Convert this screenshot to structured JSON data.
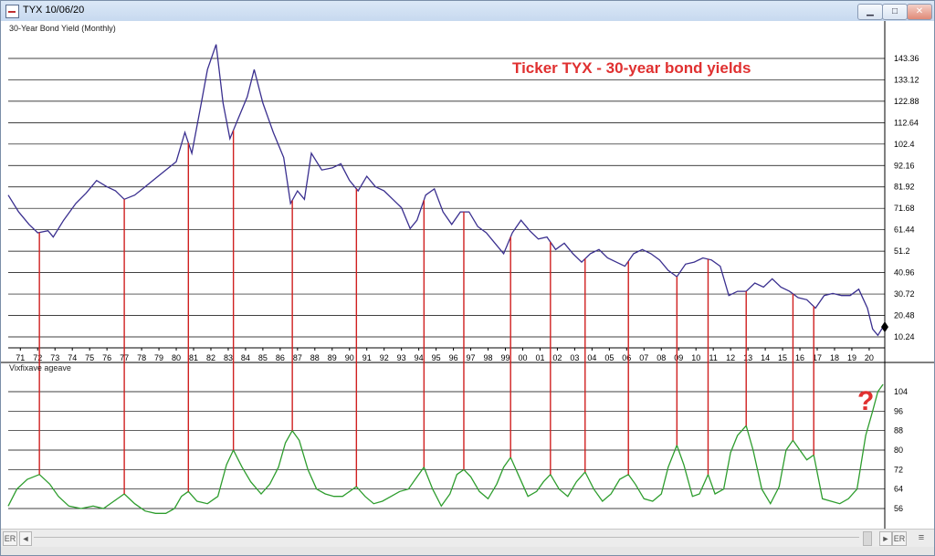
{
  "window": {
    "title": "TYX 10/06/20",
    "minimize_icon": "minimize-icon",
    "maximize_icon": "maximize-icon",
    "close_icon": "close-icon"
  },
  "chart_data": [
    {
      "type": "line",
      "title": "30-Year Bond Yield (Monthly)",
      "annotation": "Ticker TYX - 30-year bond yields",
      "ytick_labels": [
        "10.24",
        "20.48",
        "30.72",
        "40.96",
        "51.2",
        "61.44",
        "71.68",
        "81.92",
        "92.16",
        "102.4",
        "112.64",
        "122.88",
        "133.12",
        "143.36"
      ],
      "yticks": [
        10.24,
        20.48,
        30.72,
        40.96,
        51.2,
        61.44,
        71.68,
        81.92,
        92.16,
        102.4,
        112.64,
        122.88,
        133.12,
        143.36
      ],
      "ylim": [
        5,
        156
      ],
      "xlim": [
        1970.3,
        2020.9
      ],
      "xtick_labels": [
        "71",
        "72",
        "73",
        "74",
        "75",
        "76",
        "77",
        "78",
        "79",
        "80",
        "81",
        "82",
        "83",
        "84",
        "85",
        "86",
        "87",
        "88",
        "89",
        "90",
        "91",
        "92",
        "93",
        "94",
        "95",
        "96",
        "97",
        "98",
        "99",
        "00",
        "01",
        "02",
        "03",
        "04",
        "05",
        "06",
        "07",
        "08",
        "09",
        "10",
        "11",
        "12",
        "13",
        "14",
        "15",
        "16",
        "17",
        "18",
        "19",
        "20"
      ],
      "xticks": [
        1971,
        1972,
        1973,
        1974,
        1975,
        1976,
        1977,
        1978,
        1979,
        1980,
        1981,
        1982,
        1983,
        1984,
        1985,
        1986,
        1987,
        1988,
        1989,
        1990,
        1991,
        1992,
        1993,
        1994,
        1995,
        1996,
        1997,
        1998,
        1999,
        2000,
        2001,
        2002,
        2003,
        2004,
        2005,
        2006,
        2007,
        2008,
        2009,
        2010,
        2011,
        2012,
        2013,
        2014,
        2015,
        2016,
        2017,
        2018,
        2019,
        2020
      ],
      "grid": true,
      "series": [
        {
          "color": "#3a2f8f",
          "x": [
            1970.3,
            1970.9,
            1971.5,
            1972.0,
            1972.6,
            1972.9,
            1973.5,
            1974.2,
            1974.8,
            1975.4,
            1976.0,
            1976.5,
            1977.0,
            1977.6,
            1978.2,
            1978.8,
            1979.4,
            1980.0,
            1980.5,
            1980.9,
            1981.4,
            1981.8,
            1982.3,
            1982.7,
            1983.1,
            1983.6,
            1984.1,
            1984.5,
            1985.0,
            1985.6,
            1986.2,
            1986.6,
            1987.0,
            1987.4,
            1987.8,
            1988.4,
            1989.0,
            1989.5,
            1990.0,
            1990.5,
            1991.0,
            1991.5,
            1992.0,
            1992.5,
            1993.0,
            1993.5,
            1993.9,
            1994.4,
            1994.9,
            1995.4,
            1995.9,
            1996.4,
            1996.9,
            1997.4,
            1997.9,
            1998.4,
            1998.9,
            1999.4,
            1999.9,
            2000.4,
            2000.9,
            2001.4,
            2001.9,
            2002.4,
            2002.9,
            2003.4,
            2003.9,
            2004.4,
            2004.9,
            2005.4,
            2005.9,
            2006.4,
            2006.9,
            2007.4,
            2007.9,
            2008.4,
            2008.9,
            2009.4,
            2009.9,
            2010.4,
            2010.9,
            2011.4,
            2011.9,
            2012.4,
            2012.9,
            2013.4,
            2013.9,
            2014.4,
            2014.9,
            2015.4,
            2015.9,
            2016.4,
            2016.9,
            2017.4,
            2017.9,
            2018.4,
            2018.9,
            2019.4,
            2019.9,
            2020.2,
            2020.5,
            2020.8
          ],
          "y": [
            78,
            70,
            64,
            60,
            61,
            58,
            66,
            74,
            79,
            85,
            82,
            80,
            76,
            78,
            82,
            86,
            90,
            94,
            108,
            98,
            120,
            138,
            150,
            122,
            105,
            115,
            125,
            138,
            122,
            108,
            96,
            74,
            80,
            76,
            98,
            90,
            91,
            93,
            85,
            80,
            87,
            82,
            80,
            76,
            72,
            62,
            66,
            78,
            81,
            70,
            64,
            70,
            70,
            63,
            60,
            55,
            50,
            60,
            66,
            61,
            57,
            58,
            52,
            55,
            50,
            46,
            50,
            52,
            48,
            46,
            44,
            50,
            52,
            50,
            47,
            42,
            39,
            45,
            46,
            48,
            47,
            44,
            30,
            32,
            32,
            36,
            34,
            38,
            34,
            32,
            29,
            28,
            24,
            30,
            31,
            30,
            30,
            33,
            24,
            14,
            11,
            15
          ]
        }
      ]
    },
    {
      "type": "line",
      "title": "Vixfixave ageave",
      "ytick_labels": [
        "56",
        "64",
        "72",
        "80",
        "88",
        "96",
        "104"
      ],
      "yticks": [
        56,
        64,
        72,
        80,
        88,
        96,
        104
      ],
      "ylim": [
        50,
        110
      ],
      "xlim": [
        1970.3,
        2020.9
      ],
      "grid": true,
      "annotation": "?",
      "series": [
        {
          "color": "#2e9d2e",
          "x": [
            1970.3,
            1970.8,
            1971.4,
            1972.1,
            1972.7,
            1973.2,
            1973.8,
            1974.5,
            1975.2,
            1975.8,
            1976.4,
            1977.0,
            1977.6,
            1978.2,
            1978.8,
            1979.4,
            1979.9,
            1980.3,
            1980.7,
            1981.2,
            1981.8,
            1982.4,
            1982.9,
            1983.3,
            1983.8,
            1984.3,
            1984.9,
            1985.4,
            1985.9,
            1986.3,
            1986.7,
            1987.1,
            1987.6,
            1988.1,
            1988.6,
            1989.1,
            1989.6,
            1990.0,
            1990.4,
            1990.9,
            1991.4,
            1991.9,
            1992.4,
            1992.9,
            1993.4,
            1993.8,
            1994.3,
            1994.8,
            1995.3,
            1995.8,
            1996.2,
            1996.6,
            1997.0,
            1997.5,
            1998.0,
            1998.5,
            1998.9,
            1999.3,
            1999.8,
            2000.3,
            2000.8,
            2001.2,
            2001.6,
            2002.1,
            2002.6,
            2003.1,
            2003.6,
            2004.1,
            2004.6,
            2005.1,
            2005.6,
            2006.1,
            2006.5,
            2007.0,
            2007.5,
            2008.0,
            2008.4,
            2008.9,
            2009.3,
            2009.8,
            2010.2,
            2010.7,
            2011.1,
            2011.6,
            2012.0,
            2012.4,
            2012.9,
            2013.3,
            2013.8,
            2014.3,
            2014.8,
            2015.2,
            2015.6,
            2016.0,
            2016.4,
            2016.8,
            2017.3,
            2017.8,
            2018.3,
            2018.8,
            2019.3,
            2019.8,
            2020.2,
            2020.5,
            2020.8
          ],
          "y": [
            57,
            64,
            68,
            70,
            66,
            61,
            57,
            56,
            57,
            56,
            59,
            62,
            58,
            55,
            54,
            54,
            56,
            61,
            63,
            59,
            58,
            61,
            74,
            80,
            73,
            67,
            62,
            66,
            73,
            83,
            88,
            84,
            72,
            64,
            62,
            61,
            61,
            63,
            65,
            61,
            58,
            59,
            61,
            63,
            64,
            68,
            73,
            64,
            57,
            62,
            70,
            72,
            69,
            63,
            60,
            66,
            73,
            77,
            69,
            61,
            63,
            67,
            70,
            64,
            61,
            67,
            71,
            64,
            59,
            62,
            68,
            70,
            66,
            60,
            59,
            62,
            73,
            82,
            74,
            61,
            62,
            70,
            62,
            64,
            79,
            86,
            90,
            80,
            64,
            58,
            65,
            80,
            84,
            80,
            76,
            78,
            60,
            59,
            58,
            60,
            64,
            86,
            96,
            104,
            107
          ]
        }
      ]
    }
  ],
  "scrollbar": {
    "left_label": "ER",
    "right_label": "ER",
    "left_arrow": "◄",
    "right_arrow": "►",
    "grip_icon": "grip-icon"
  }
}
